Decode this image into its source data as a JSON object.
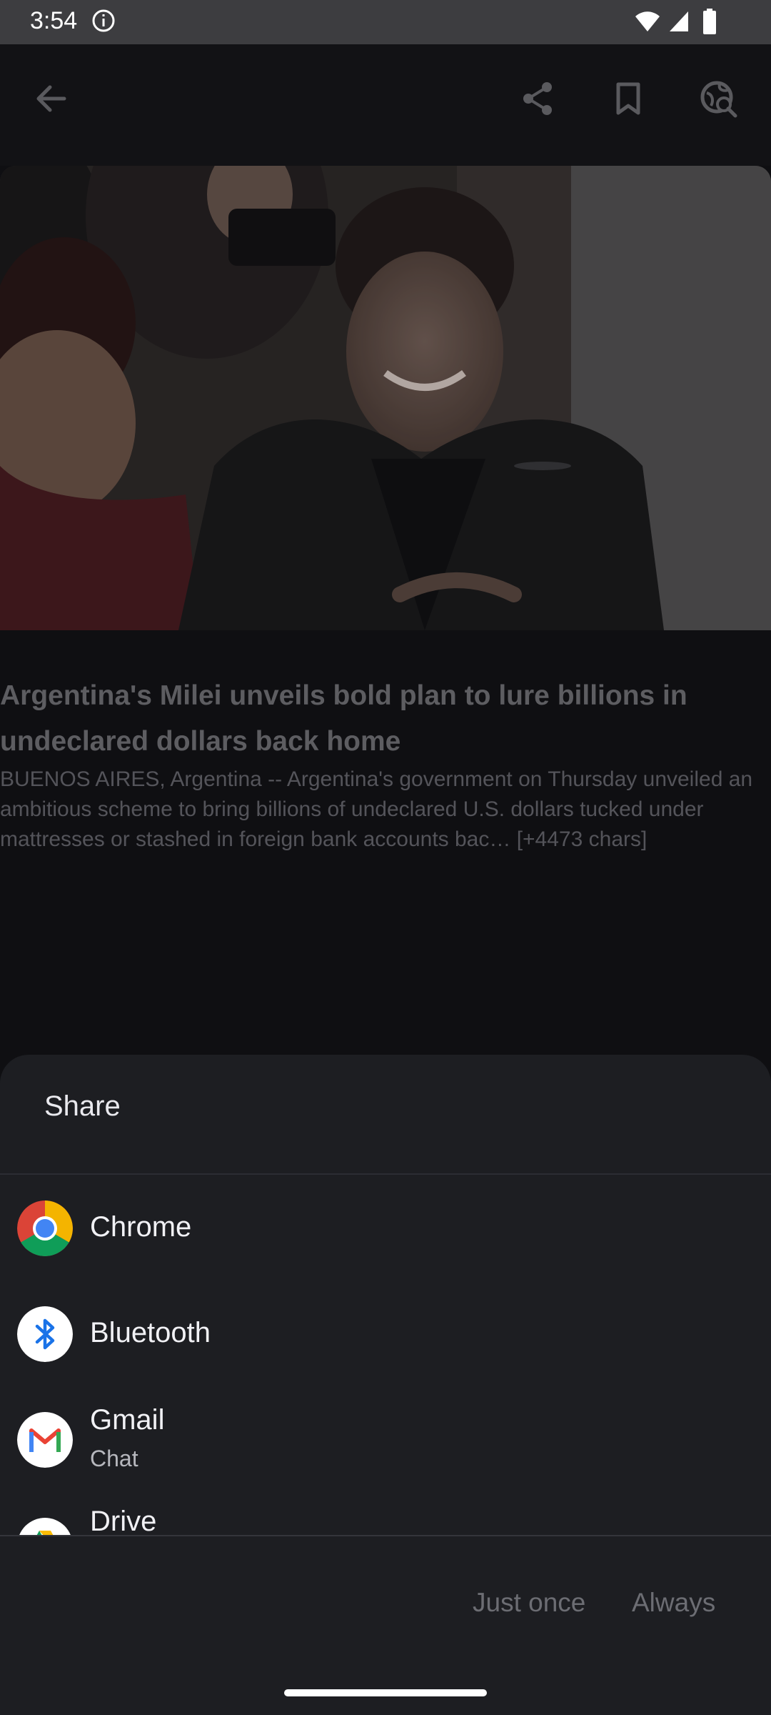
{
  "status_bar": {
    "time": "3:54"
  },
  "article": {
    "title": "Argentina's Milei unveils bold plan to lure billions in undeclared dollars back home",
    "summary": "BUENOS AIRES, Argentina -- Argentina's government on Thursday unveiled an ambitious scheme to bring billions of undeclared U.S. dollars tucked under mattresses or stashed in foreign bank accounts bac… [+4473 chars]"
  },
  "share_sheet": {
    "title": "Share",
    "apps": [
      {
        "label": "Chrome"
      },
      {
        "label": "Bluetooth"
      },
      {
        "label": "Gmail",
        "sub": "Chat"
      },
      {
        "label": "Drive"
      }
    ],
    "actions": {
      "just_once": "Just once",
      "always": "Always"
    }
  }
}
